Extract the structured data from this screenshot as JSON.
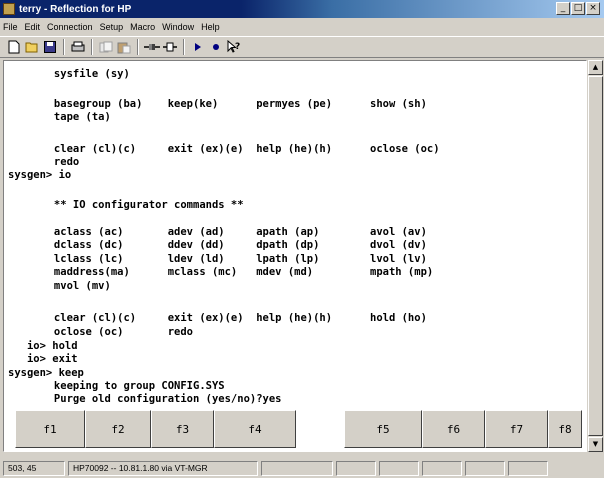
{
  "window": {
    "title": "terry - Reflection for HP",
    "minimize_glyph": "_",
    "maximize_glyph": "□",
    "close_glyph": "×"
  },
  "menu": [
    "File",
    "Edit",
    "Connection",
    "Setup",
    "Macro",
    "Window",
    "Help"
  ],
  "toolbar": {
    "icons": [
      "new-document-icon",
      "open-folder-icon",
      "save-icon",
      "print-icon",
      "cut-icon",
      "paste-icon",
      "connect-icon",
      "disconnect-icon",
      "play-macro-icon",
      "record-macro-icon",
      "context-help-icon"
    ]
  },
  "terminal": {
    "lines": [
      "      sysfile (sy)",
      "",
      "      basegroup (ba)    keep(ke)      permyes (pe)      show (sh)",
      "      tape (ta)",
      "",
      "      clear (cl)(c)     exit (ex)(e)  help (he)(h)      oclose (oc)",
      "      redo",
      "sysgen> io",
      "",
      "      ** IO configurator commands **",
      "",
      "      aclass (ac)       adev (ad)     apath (ap)        avol (av)",
      "      dclass (dc)       ddev (dd)     dpath (dp)        dvol (dv)",
      "      lclass (lc)       ldev (ld)     lpath (lp)        lvol (lv)",
      "      maddress(ma)      mclass (mc)   mdev (md)         mpath (mp)",
      "      mvol (mv)",
      "",
      "      clear (cl)(c)     exit (ex)(e)  help (he)(h)      hold (ho)",
      "      oclose (oc)       redo",
      "   io> hold",
      "   io> exit",
      "sysgen> keep",
      "      keeping to group CONFIG.SYS",
      "      Purge old configuration (yes/no)?yes"
    ]
  },
  "function_keys": [
    "f1",
    "f2",
    "f3",
    "f4",
    "f5",
    "f6",
    "f7",
    "f8"
  ],
  "status": {
    "cursor": "503, 45",
    "connection": "HP70092 -- 10.81.1.80 via VT-MGR"
  }
}
